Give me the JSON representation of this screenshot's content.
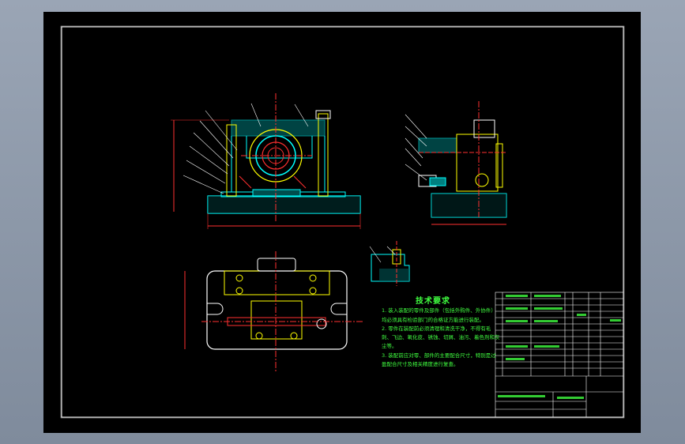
{
  "drawing": {
    "tech_requirements": {
      "title": "技术要求",
      "items": [
        "1. 装入装配的零件及部件（包括外购件、外协件）均必须具有检验部门的合格证方能进行装配。",
        "2. 零件在装配前必须清理和清洗干净，不得有毛刺、飞边、氧化皮、锈蚀、切屑、油污、着色剂和灰尘等。",
        "3. 装配前应对零、部件的主要配合尺寸，特别是过盈配合尺寸及相关精度进行复查。"
      ]
    },
    "colors": {
      "frame": "#ffffff",
      "part": "#00ffff",
      "hidden": "#ff3030",
      "annotation": "#ffff00",
      "text": "#40ff40",
      "background": "#000000"
    }
  }
}
